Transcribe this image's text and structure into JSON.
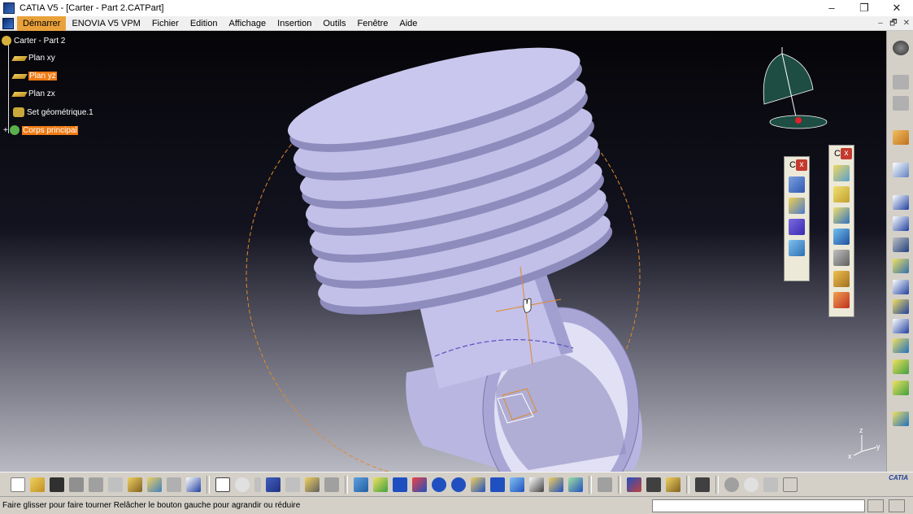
{
  "window": {
    "title": "CATIA V5 - [Carter - Part 2.CATPart]",
    "controls": [
      "–",
      "❐",
      "✕"
    ]
  },
  "menu": {
    "items": [
      "Démarrer",
      "ENOVIA V5 VPM",
      "Fichier",
      "Edition",
      "Affichage",
      "Insertion",
      "Outils",
      "Fenêtre",
      "Aide"
    ],
    "active": "Démarrer",
    "mdi_controls": [
      "–",
      "🗗",
      "✕"
    ]
  },
  "tree": {
    "root": "Carter - Part 2",
    "items": [
      {
        "label": "Plan xy",
        "selected": false
      },
      {
        "label": "Plan yz",
        "selected": true
      },
      {
        "label": "Plan zx",
        "selected": false
      },
      {
        "label": "Set géométrique.1",
        "selected": false
      },
      {
        "label": "Corps principal",
        "selected": true
      }
    ]
  },
  "floating_toolbars": [
    {
      "title": "C",
      "close": "x"
    },
    {
      "title": "C",
      "close": "x"
    }
  ],
  "axis": {
    "x": "x",
    "y": "y",
    "z": "z"
  },
  "logo": "CATIA",
  "status": {
    "message": "Faire glisser pour faire tourner  Relâcher le bouton gauche pour agrandir ou réduire"
  },
  "colors": {
    "accent": "#f07a12",
    "part": "#b8b5e0",
    "part_dark": "#8e8bbd",
    "compass": "#1d4d43"
  }
}
